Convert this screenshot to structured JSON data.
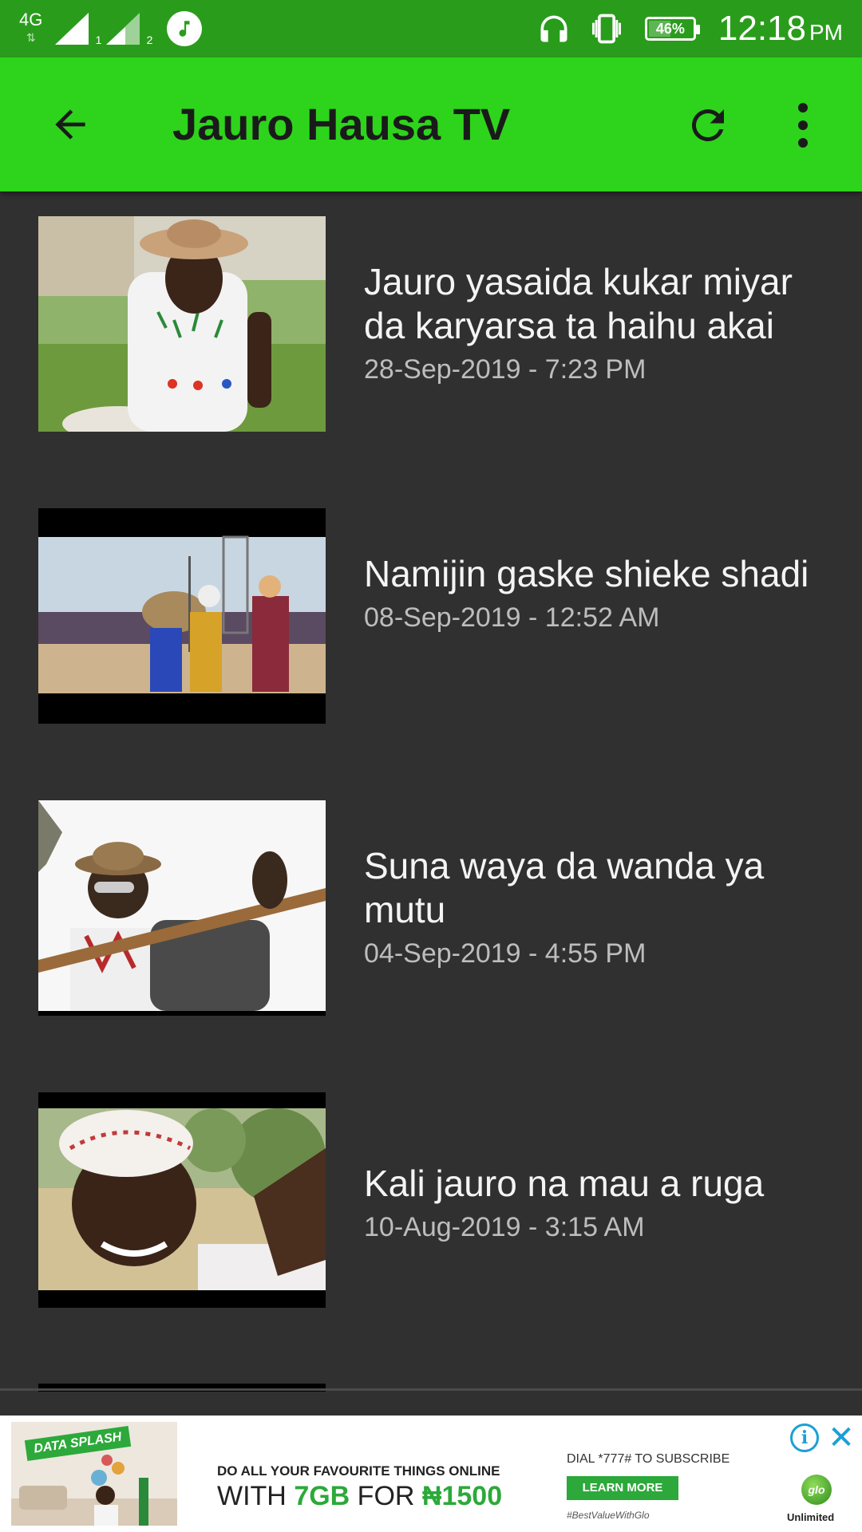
{
  "status_bar": {
    "network": "4G",
    "sim1_index": "1",
    "sim2_index": "2",
    "battery": "46%",
    "battery_level": 0.46,
    "time": "12:18",
    "ampm": "PM",
    "icons": [
      "signal-icon",
      "music-icon",
      "headphones-icon",
      "vibrate-icon",
      "battery-icon"
    ]
  },
  "toolbar": {
    "title": "Jauro Hausa TV",
    "icons": [
      "back-arrow-icon",
      "refresh-icon",
      "more-vert-icon"
    ]
  },
  "videos": [
    {
      "title": "Jauro yasaida kukar miyar da karyarsa ta haihu akai",
      "date": "28-Sep-2019 - 7:23 PM"
    },
    {
      "title": "Namijin gaske shieke shadi",
      "date": "08-Sep-2019 - 12:52 AM"
    },
    {
      "title": "Suna waya da wanda ya mutu",
      "date": "04-Sep-2019 - 4:55 PM"
    },
    {
      "title": "Kali jauro na mau a ruga",
      "date": "10-Aug-2019 - 3:15 AM"
    }
  ],
  "ad": {
    "tag": "DATA SPLASH",
    "line1": "DO ALL YOUR FAVOURITE THINGS ONLINE",
    "line2_prefix": "WITH ",
    "line2_highlight": "7GB",
    "line2_middle": " FOR ",
    "line2_price": "₦1500",
    "dial": "DIAL *777# TO SUBSCRIBE",
    "cta": "LEARN MORE",
    "hashtag": "#BestValueWithGlo",
    "brand": "glo",
    "brand_sub": "Unlimited",
    "colors": {
      "green": "#2ca93a",
      "info": "#1aa0d6"
    }
  },
  "colors": {
    "status_bar": "#2a9c1c",
    "toolbar": "#2dd41b",
    "background": "#303030"
  }
}
